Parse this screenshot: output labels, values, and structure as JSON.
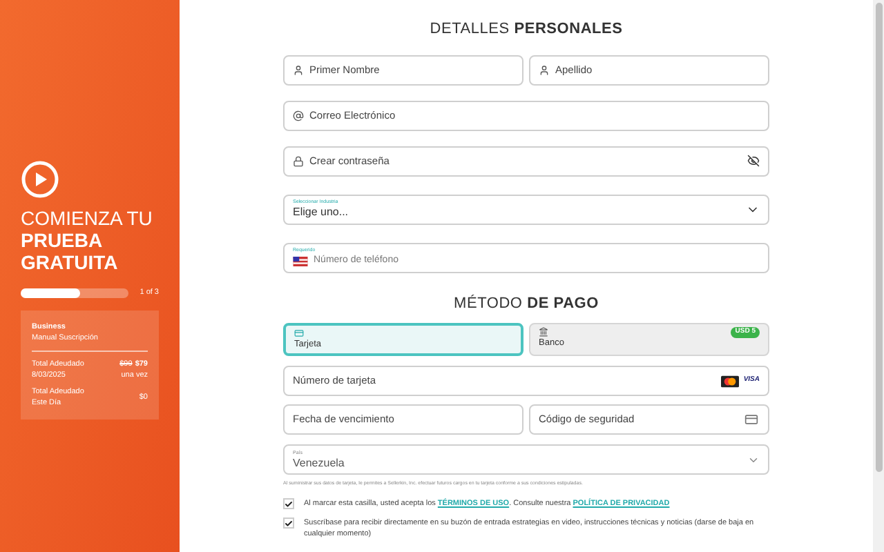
{
  "sidebar": {
    "title_light": "COMIENZA TU",
    "title_bold": "PRUEBA GRATUITA",
    "progress": {
      "level": 0.55,
      "text": "1 of 3"
    },
    "summary": {
      "plan": "Business",
      "billing": "Manual Suscripción",
      "due_label": "Total Adeudado 8/03/2025",
      "old_price": "$99",
      "price": "$79",
      "price_note": "una vez",
      "today_label": "Total Adeudado Este Día",
      "today_amount": "$0"
    }
  },
  "personal": {
    "heading_light": "DETALLES",
    "heading_bold": "PERSONALES",
    "first_name": {
      "placeholder": "Primer Nombre"
    },
    "last_name": {
      "placeholder": "Apellido"
    },
    "email": {
      "placeholder": "Correo Electrónico"
    },
    "password": {
      "placeholder": "Crear contraseña"
    },
    "industry": {
      "label": "Seleccionar Industria",
      "value": "Elige uno..."
    },
    "phone": {
      "label": "Requerido",
      "placeholder": "Número de teléfono"
    }
  },
  "payment": {
    "heading_light": "MÉTODO",
    "heading_bold": "DE PAGO",
    "methods": [
      {
        "kind": "card",
        "label": "Tarjeta",
        "selected": true
      },
      {
        "kind": "bank",
        "label": "Banco",
        "selected": false,
        "badge": "USD 5"
      }
    ],
    "card_number": {
      "placeholder": "Número de tarjeta"
    },
    "visa": "VISA",
    "expiry": {
      "placeholder": "Fecha de vencimiento"
    },
    "cvc": {
      "placeholder": "Código de seguridad"
    },
    "country": {
      "label": "País",
      "value": "Venezuela"
    },
    "disclaimer": "Al suministrar sus datos de tarjeta, le permites a Sellerkin, Inc. efectuar futuros cargos en tu tarjeta conforme a sus condiciones estipuladas.",
    "consents": [
      {
        "checked": true,
        "text": "Al marcar esta casilla, usted acepta los",
        "link1": "TÉRMINOS DE USO",
        "middle": ". Consulte nuestra",
        "link2": "POLÍTICA DE PRIVACIDAD"
      },
      {
        "checked": true,
        "text": "Suscríbase para recibir directamente en su buzón de entrada estrategias en video, instrucciones técnicas y noticias (darse de baja en cualquier momento)"
      }
    ]
  }
}
